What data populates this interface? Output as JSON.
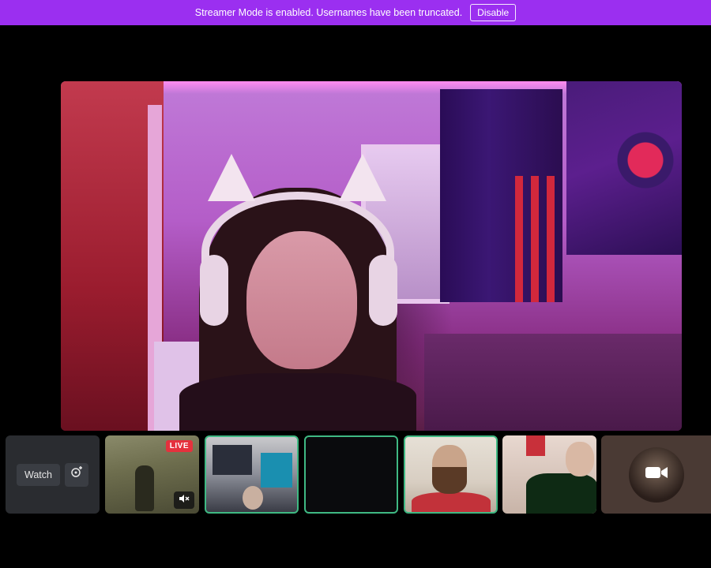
{
  "banner": {
    "message": "Streamer Mode is enabled. Usernames have been truncated.",
    "disable_label": "Disable",
    "color": "#9b2ff0"
  },
  "main_stream": {
    "description_icon": "video-feed"
  },
  "tiles": {
    "watch": {
      "label": "Watch",
      "icon": "popout-icon"
    },
    "game": {
      "badge": "LIVE",
      "mute_icon": "volume-muted-icon"
    },
    "camera_tile": {
      "icon": "video-camera-icon"
    }
  },
  "colors": {
    "active_border": "#3fb983",
    "live_red": "#e5313d",
    "background": "#000000"
  }
}
